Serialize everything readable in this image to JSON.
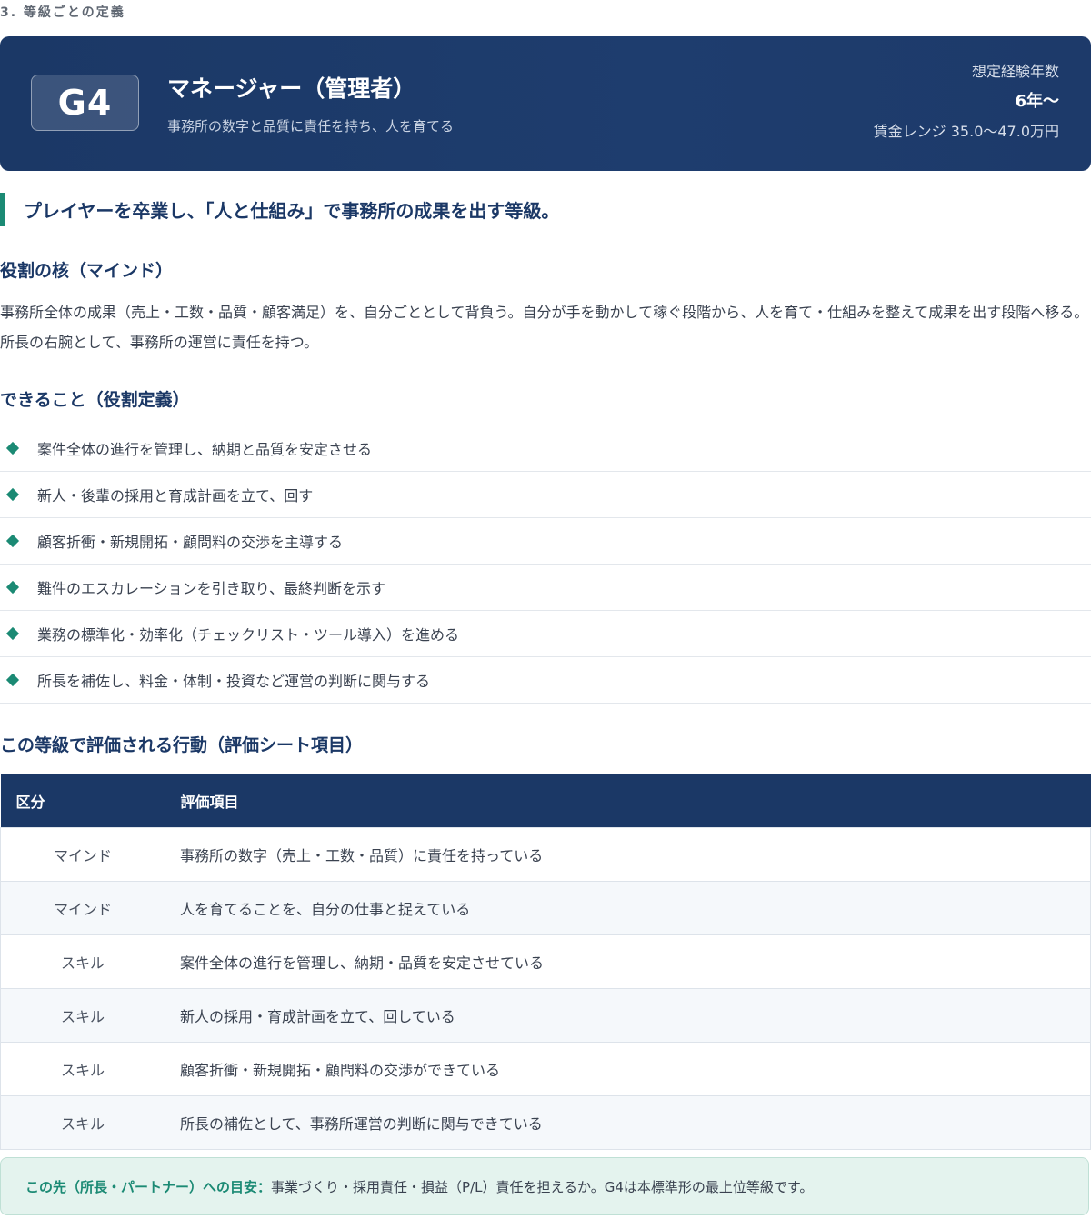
{
  "section_label": "3. 等級ごとの定義",
  "banner": {
    "grade": "G4",
    "title": "マネージャー（管理者）",
    "subtitle": "事務所の数字と品質に責任を持ち、人を育てる",
    "experience_label": "想定経験年数",
    "experience_value": "6年〜",
    "wage_range": "賃金レンジ 35.0〜47.0万円"
  },
  "lead": "プレイヤーを卒業し、「人と仕組み」で事務所の成果を出す等級。",
  "mind": {
    "heading": "役割の核（マインド）",
    "text": "事務所全体の成果（売上・工数・品質・顧客満足）を、自分ごととして背負う。自分が手を動かして稼ぐ段階から、人を育て・仕組みを整えて成果を出す段階へ移る。所長の右腕として、事務所の運営に責任を持つ。"
  },
  "abilities": {
    "heading": "できること（役割定義）",
    "items": [
      "案件全体の進行を管理し、納期と品質を安定させる",
      "新人・後輩の採用と育成計画を立て、回す",
      "顧客折衝・新規開拓・顧問料の交渉を主導する",
      "難件のエスカレーションを引き取り、最終判断を示す",
      "業務の標準化・効率化（チェックリスト・ツール導入）を進める",
      "所長を補佐し、料金・体制・投資など運営の判断に関与する"
    ]
  },
  "evaluation": {
    "heading": "この等級で評価される行動（評価シート項目）",
    "columns": [
      "区分",
      "評価項目"
    ],
    "rows": [
      {
        "category": "マインド",
        "item": "事務所の数字（売上・工数・品質）に責任を持っている"
      },
      {
        "category": "マインド",
        "item": "人を育てることを、自分の仕事と捉えている"
      },
      {
        "category": "スキル",
        "item": "案件全体の進行を管理し、納期・品質を安定させている"
      },
      {
        "category": "スキル",
        "item": "新人の採用・育成計画を立て、回している"
      },
      {
        "category": "スキル",
        "item": "顧客折衝・新規開拓・顧問料の交渉ができている"
      },
      {
        "category": "スキル",
        "item": "所長の補佐として、事務所運営の判断に関与できている"
      }
    ]
  },
  "note": {
    "label": "この先（所長・パートナー）への目安：",
    "text": "事業づくり・採用責任・損益（P/L）責任を担えるか。G4は本標準形の最上位等級です。"
  },
  "colors": {
    "navy": "#1b3866",
    "accent_green": "#1b8a74",
    "note_bg": "#e4f3ee"
  }
}
